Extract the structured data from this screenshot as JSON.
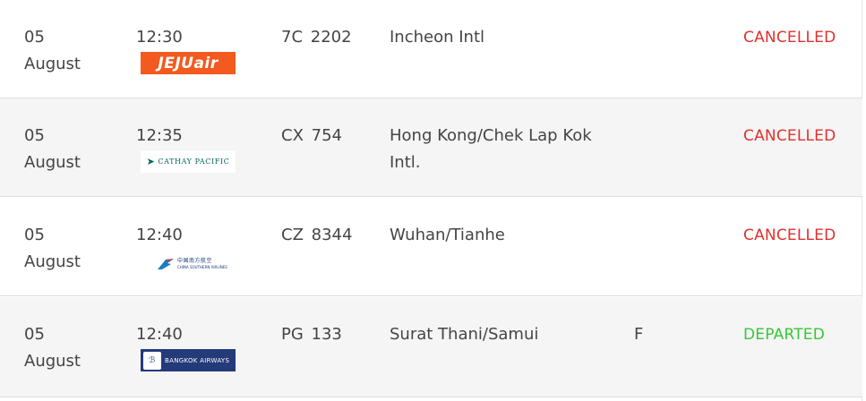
{
  "flights": [
    {
      "date_day": "05",
      "date_month": "August",
      "time": "12:30",
      "airline_logo": "JEJUair",
      "flight_number": "7C 2202",
      "destination": "Incheon Intl",
      "gate": "",
      "status": "CANCELLED"
    },
    {
      "date_day": "05",
      "date_month": "August",
      "time": "12:35",
      "airline_logo": "CATHAY PACIFIC",
      "flight_number": "CX 754",
      "destination": "Hong Kong/Chek Lap Kok Intl.",
      "gate": "",
      "status": "CANCELLED"
    },
    {
      "date_day": "05",
      "date_month": "August",
      "time": "12:40",
      "airline_logo_cn": "中国南方航空",
      "airline_logo_en": "CHINA SOUTHERN AIRLINES",
      "flight_number": "CZ 8344",
      "destination": "Wuhan/Tianhe",
      "gate": "",
      "status": "CANCELLED"
    },
    {
      "date_day": "05",
      "date_month": "August",
      "time": "12:40",
      "airline_logo": "BANGKOK AIRWAYS",
      "flight_number": "PG 133",
      "destination": "Surat Thani/Samui",
      "gate": "F",
      "status": "DEPARTED"
    }
  ],
  "colors": {
    "cancelled": "#e0312e",
    "departed": "#37c837",
    "row_alt_bg": "#f5f5f5",
    "jeju_orange": "#f25a1f",
    "bangkok_blue": "#243b7a"
  },
  "icons": {
    "jeju": "jejuair-logo-icon",
    "cathay": "cathay-pacific-logo-icon",
    "csair": "china-southern-logo-icon",
    "bangkok": "bangkok-airways-logo-icon"
  }
}
